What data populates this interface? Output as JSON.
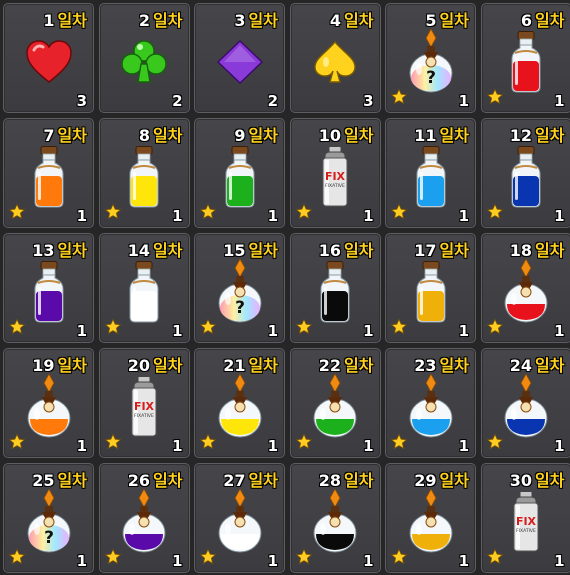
{
  "day_suffix": "일차",
  "rewards": [
    {
      "day": "1",
      "item": "heart-icon",
      "count": "3",
      "star": false
    },
    {
      "day": "2",
      "item": "club-icon",
      "count": "2",
      "star": false
    },
    {
      "day": "3",
      "item": "diamond-icon",
      "count": "2",
      "star": false
    },
    {
      "day": "4",
      "item": "spade-icon",
      "count": "3",
      "star": false
    },
    {
      "day": "5",
      "item": "mystery-flask-icon",
      "count": "1",
      "star": true
    },
    {
      "day": "6",
      "item": "red-dye-bottle-icon",
      "count": "1",
      "star": true
    },
    {
      "day": "7",
      "item": "orange-dye-bottle-icon",
      "count": "1",
      "star": true
    },
    {
      "day": "8",
      "item": "yellow-dye-bottle-icon",
      "count": "1",
      "star": true
    },
    {
      "day": "9",
      "item": "green-dye-bottle-icon",
      "count": "1",
      "star": true
    },
    {
      "day": "10",
      "item": "fix-spray-icon",
      "count": "1",
      "star": true
    },
    {
      "day": "11",
      "item": "sky-blue-dye-bottle-icon",
      "count": "1",
      "star": true
    },
    {
      "day": "12",
      "item": "blue-dye-bottle-icon",
      "count": "1",
      "star": true
    },
    {
      "day": "13",
      "item": "purple-dye-bottle-icon",
      "count": "1",
      "star": true
    },
    {
      "day": "14",
      "item": "white-dye-bottle-icon",
      "count": "1",
      "star": true
    },
    {
      "day": "15",
      "item": "mystery-flask-icon",
      "count": "1",
      "star": true
    },
    {
      "day": "16",
      "item": "black-dye-bottle-icon",
      "count": "1",
      "star": true
    },
    {
      "day": "17",
      "item": "gold-dye-bottle-icon",
      "count": "1",
      "star": true
    },
    {
      "day": "18",
      "item": "red-dye-flask-icon",
      "count": "1",
      "star": true
    },
    {
      "day": "19",
      "item": "orange-dye-flask-icon",
      "count": "1",
      "star": true
    },
    {
      "day": "20",
      "item": "fix-spray-icon",
      "count": "1",
      "star": true
    },
    {
      "day": "21",
      "item": "yellow-dye-flask-icon",
      "count": "1",
      "star": true
    },
    {
      "day": "22",
      "item": "green-dye-flask-icon",
      "count": "1",
      "star": true
    },
    {
      "day": "23",
      "item": "sky-blue-dye-flask-icon",
      "count": "1",
      "star": true
    },
    {
      "day": "24",
      "item": "blue-dye-flask-icon",
      "count": "1",
      "star": true
    },
    {
      "day": "25",
      "item": "mystery-flask-icon",
      "count": "1",
      "star": true
    },
    {
      "day": "26",
      "item": "purple-dye-flask-icon",
      "count": "1",
      "star": true
    },
    {
      "day": "27",
      "item": "white-dye-flask-icon",
      "count": "1",
      "star": true
    },
    {
      "day": "28",
      "item": "black-dye-flask-icon",
      "count": "1",
      "star": true
    },
    {
      "day": "29",
      "item": "gold-dye-flask-icon",
      "count": "1",
      "star": true
    },
    {
      "day": "30",
      "item": "fix-spray-icon",
      "count": "1",
      "star": true
    }
  ],
  "colors": {
    "red": "#e8121c",
    "orange": "#ff7a0a",
    "yellow": "#ffe60a",
    "green": "#1cb01c",
    "sky-blue": "#1aa0ee",
    "blue": "#0a35b0",
    "purple": "#5a0aa8",
    "white": "#ffffff",
    "black": "#0a0a0a",
    "gold": "#f0b00a",
    "heart": "#e8222a",
    "club": "#39c81e",
    "diamond": "#8a3ad8",
    "spade": "#ffd21e",
    "fix-red": "#d81c1c"
  }
}
